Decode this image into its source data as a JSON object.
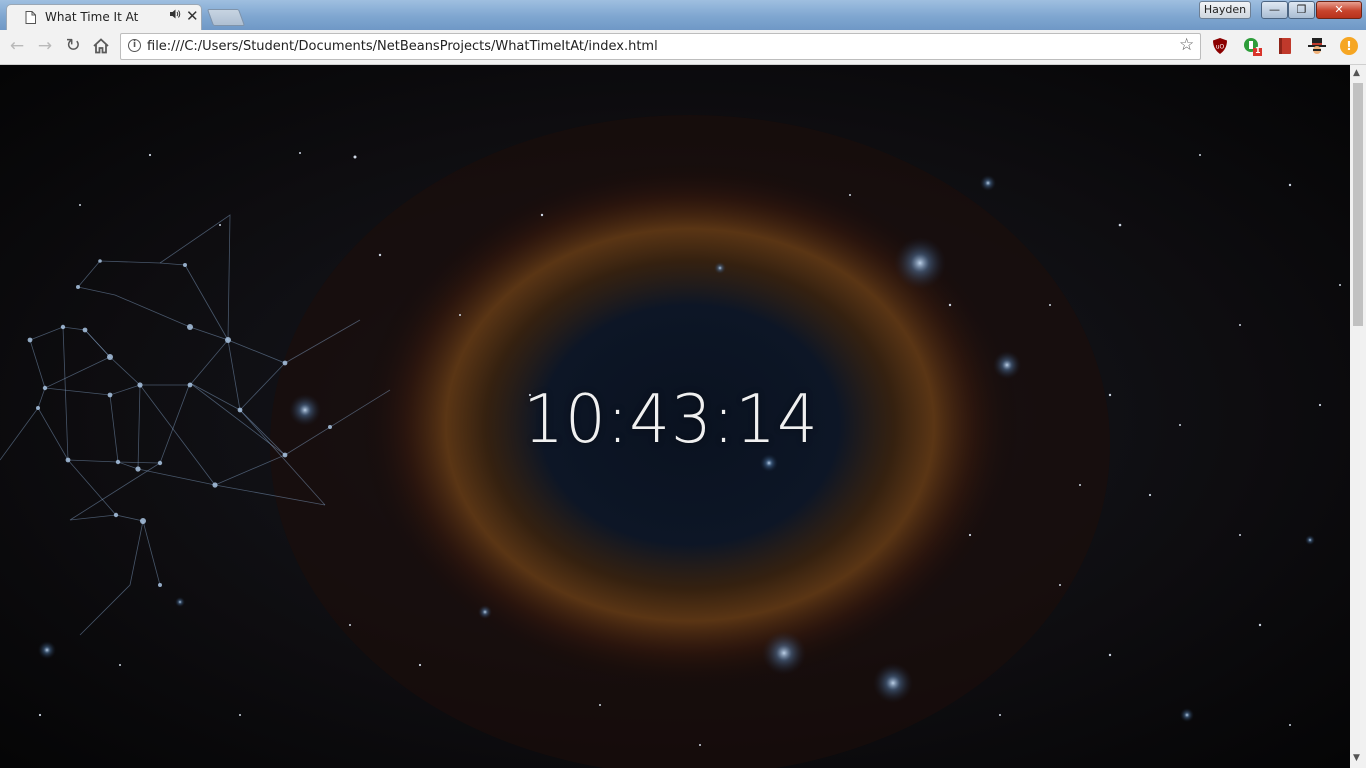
{
  "tab": {
    "title": "What Time It At",
    "close_glyph": "✕",
    "audio_icon": "speaker-icon"
  },
  "window": {
    "user": "Hayden",
    "minimize": "—",
    "maximize": "❐",
    "close": "✕"
  },
  "omnibox": {
    "url": "file:///C:/Users/Student/Documents/NetBeansProjects/WhatTimeItAt/index.html"
  },
  "extensions": {
    "green_badge_count": "1",
    "warning_glyph": "!"
  },
  "clock": {
    "time": "10:43:14"
  },
  "colors": {
    "ublock": "#8b0000",
    "green_ext": "#2e9d3a",
    "book_ext": "#c0392b",
    "warning": "#f6a623"
  }
}
